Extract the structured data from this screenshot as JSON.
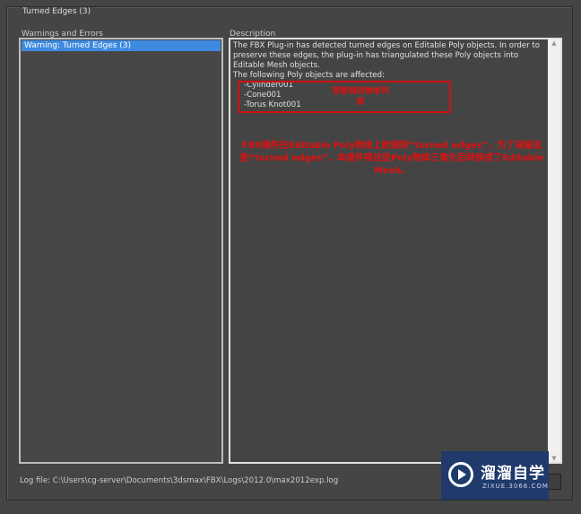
{
  "group": {
    "title": "Turned Edges (3)"
  },
  "warnings": {
    "label": "Warnings and Errors",
    "items": [
      "Warning: Turned Edges (3)"
    ]
  },
  "description": {
    "label": "Description",
    "lines": [
      "The FBX Plug-in has detected turned edges on Editable Poly objects. In order to preserve these edges, the plug-in has triangulated these Poly objects into Editable Mesh objects.",
      "The following Poly objects are affected:"
    ],
    "objects": [
      "-Cylinder001",
      "-Cone001",
      "-Torus Knot001"
    ],
    "annotation_box": "受影响的物体列表",
    "annotation_text": "FBX插件在Editable Poly物体上检测到“turned edges”，为了保留这些“turned edges”，本插件将这些Poly物体三角化后转换成了Editable Mesh。"
  },
  "log": {
    "text": "Log file: C:\\Users\\cg-server\\Documents\\3dsmax\\FBX\\Logs\\2012.0\\max2012exp.log"
  },
  "watermark": {
    "title": "溜溜自学",
    "subtitle": "ZIXUE.3066.COM"
  }
}
